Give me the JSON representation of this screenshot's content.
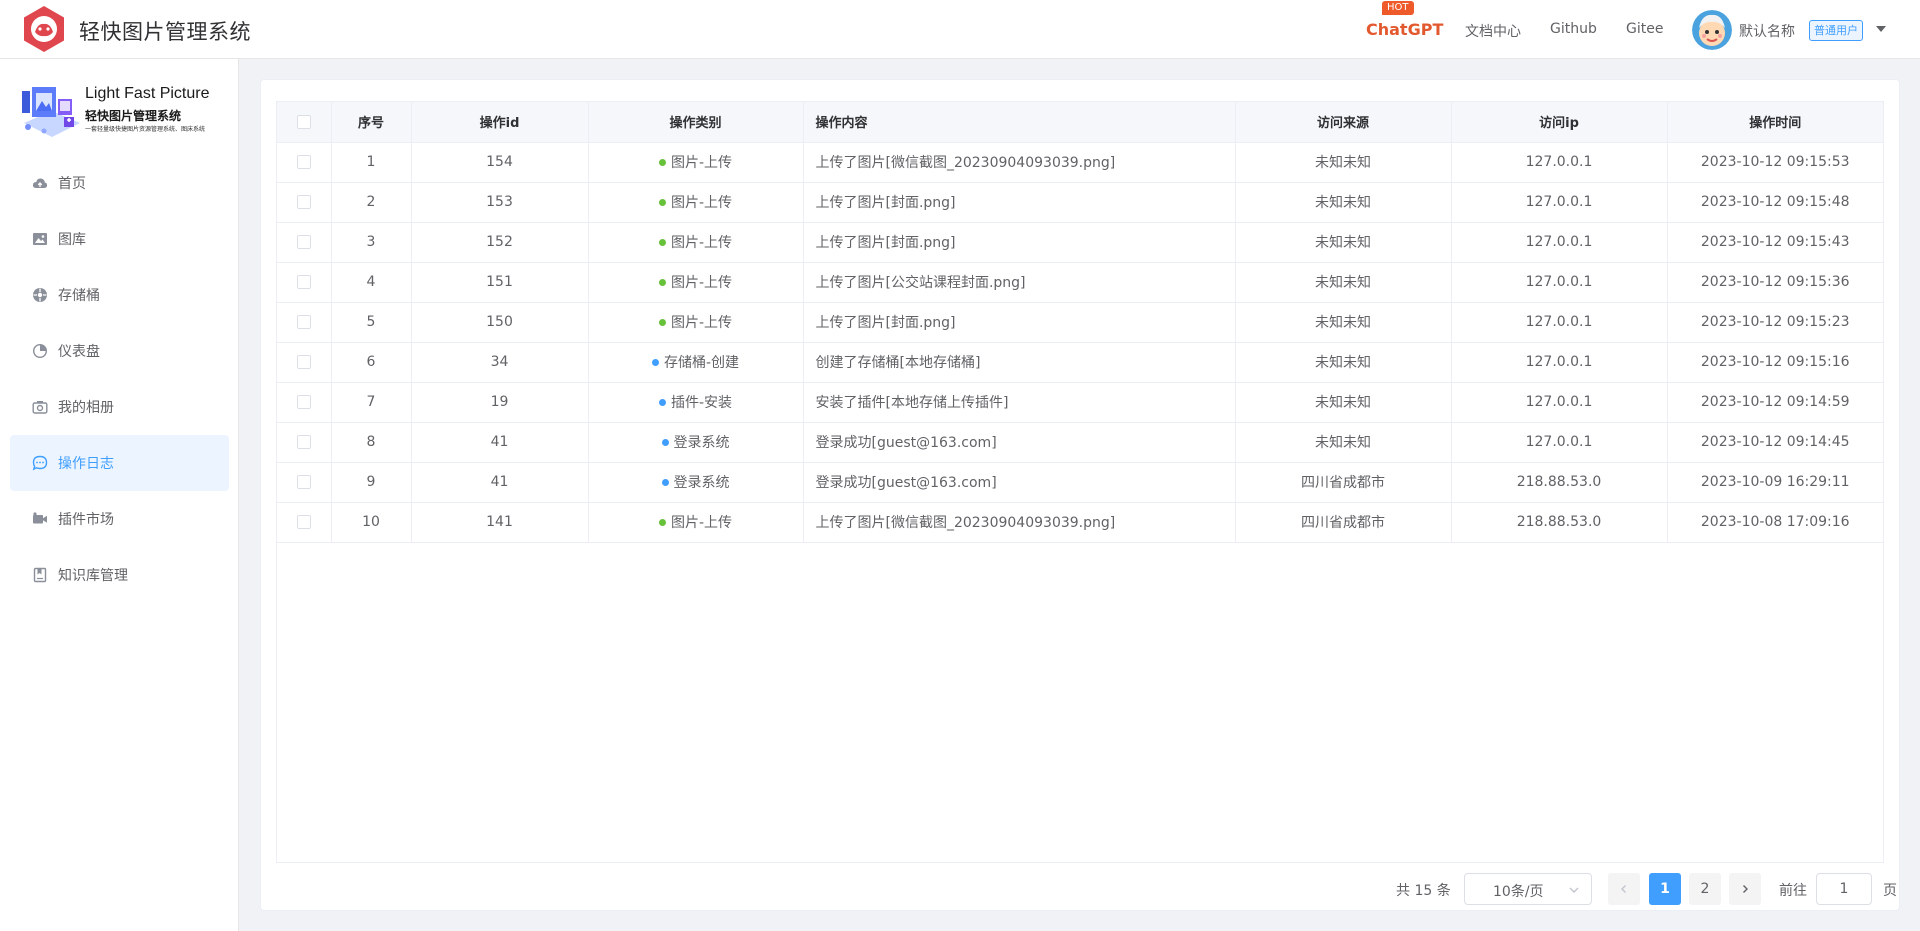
{
  "header": {
    "app_title": "轻快图片管理系统",
    "nav": {
      "chatgpt": "ChatGPT",
      "hot_badge": "HOT",
      "docs": "文档中心",
      "github": "Github",
      "gitee": "Gitee"
    },
    "user": {
      "name": "默认名称",
      "role_tag": "普通用户"
    }
  },
  "sidebar": {
    "logo": {
      "title_en": "Light Fast Picture",
      "title_cn": "轻快图片管理系统",
      "subtitle": "一套轻量级快捷图片资源管理系统、图床系统"
    },
    "items": [
      {
        "label": "首页",
        "icon": "cloud-icon",
        "active": false
      },
      {
        "label": "图库",
        "icon": "image-icon",
        "active": false
      },
      {
        "label": "存储桶",
        "icon": "bucket-icon",
        "active": false
      },
      {
        "label": "仪表盘",
        "icon": "dashboard-icon",
        "active": false
      },
      {
        "label": "我的相册",
        "icon": "camera-icon",
        "active": false
      },
      {
        "label": "操作日志",
        "icon": "chat-icon",
        "active": true
      },
      {
        "label": "插件市场",
        "icon": "video-icon",
        "active": false
      },
      {
        "label": "知识库管理",
        "icon": "book-icon",
        "active": false
      }
    ]
  },
  "table": {
    "columns": [
      "序号",
      "操作id",
      "操作类别",
      "操作内容",
      "访问来源",
      "访问ip",
      "操作时间"
    ],
    "rows": [
      {
        "index": "1",
        "id": "154",
        "category": "图片-上传",
        "dot": "green",
        "content": "上传了图片[微信截图_20230904093039.png]",
        "source": "未知未知",
        "ip": "127.0.0.1",
        "time": "2023-10-12 09:15:53"
      },
      {
        "index": "2",
        "id": "153",
        "category": "图片-上传",
        "dot": "green",
        "content": "上传了图片[封面.png]",
        "source": "未知未知",
        "ip": "127.0.0.1",
        "time": "2023-10-12 09:15:48"
      },
      {
        "index": "3",
        "id": "152",
        "category": "图片-上传",
        "dot": "green",
        "content": "上传了图片[封面.png]",
        "source": "未知未知",
        "ip": "127.0.0.1",
        "time": "2023-10-12 09:15:43"
      },
      {
        "index": "4",
        "id": "151",
        "category": "图片-上传",
        "dot": "green",
        "content": "上传了图片[公交站课程封面.png]",
        "source": "未知未知",
        "ip": "127.0.0.1",
        "time": "2023-10-12 09:15:36"
      },
      {
        "index": "5",
        "id": "150",
        "category": "图片-上传",
        "dot": "green",
        "content": "上传了图片[封面.png]",
        "source": "未知未知",
        "ip": "127.0.0.1",
        "time": "2023-10-12 09:15:23"
      },
      {
        "index": "6",
        "id": "34",
        "category": "存储桶-创建",
        "dot": "blue",
        "content": "创建了存储桶[本地存储桶]",
        "source": "未知未知",
        "ip": "127.0.0.1",
        "time": "2023-10-12 09:15:16"
      },
      {
        "index": "7",
        "id": "19",
        "category": "插件-安装",
        "dot": "blue",
        "content": "安装了插件[本地存储上传插件]",
        "source": "未知未知",
        "ip": "127.0.0.1",
        "time": "2023-10-12 09:14:59"
      },
      {
        "index": "8",
        "id": "41",
        "category": "登录系统",
        "dot": "blue",
        "content": "登录成功[guest@163.com]",
        "source": "未知未知",
        "ip": "127.0.0.1",
        "time": "2023-10-12 09:14:45"
      },
      {
        "index": "9",
        "id": "41",
        "category": "登录系统",
        "dot": "blue",
        "content": "登录成功[guest@163.com]",
        "source": "四川省成都市",
        "ip": "218.88.53.0",
        "time": "2023-10-09 16:29:11"
      },
      {
        "index": "10",
        "id": "141",
        "category": "图片-上传",
        "dot": "green",
        "content": "上传了图片[微信截图_20230904093039.png]",
        "source": "四川省成都市",
        "ip": "218.88.53.0",
        "time": "2023-10-08 17:09:16"
      }
    ]
  },
  "pagination": {
    "total_text": "共 15 条",
    "page_size": "10条/页",
    "pages": [
      "1",
      "2"
    ],
    "current_page": "1",
    "goto_label": "前往",
    "goto_value": "1",
    "goto_unit": "页"
  },
  "colors": {
    "accent": "#409eff",
    "dot_green": "#67c23a",
    "dot_blue": "#409eff",
    "hot": "#ef5a2a",
    "logo": "#e0464e"
  }
}
